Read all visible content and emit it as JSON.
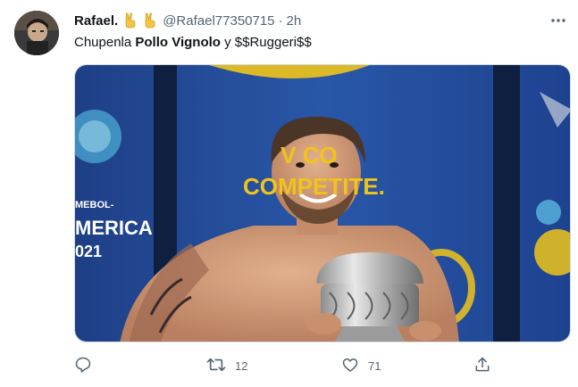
{
  "author": {
    "display_name": "Rafael.",
    "handle": "@Rafael77350715",
    "separator": "·",
    "time": "2h"
  },
  "tweet": {
    "text_start": "Chupenla ",
    "text_bold": "Pollo Vignolo",
    "text_end": " y $$Ruggeri$$"
  },
  "image_text": {
    "banner_line1": "V CO",
    "banner_line2": "COMPETITE.",
    "side_line1": "MEBOL-",
    "side_line2": "MERICA",
    "side_line3": "021"
  },
  "actions": {
    "reply_count": "",
    "retweet_count": "12",
    "like_count": "71"
  },
  "icons": {
    "reply": "reply-icon",
    "retweet": "retweet-icon",
    "like": "like-icon",
    "share": "share-icon",
    "more": "more-icon",
    "emoji": "victory-hand-icon"
  },
  "colors": {
    "text_primary": "#0f1419",
    "text_secondary": "#536471",
    "banner_blue": "#1f4f9e",
    "banner_yellow": "#f0c419"
  }
}
